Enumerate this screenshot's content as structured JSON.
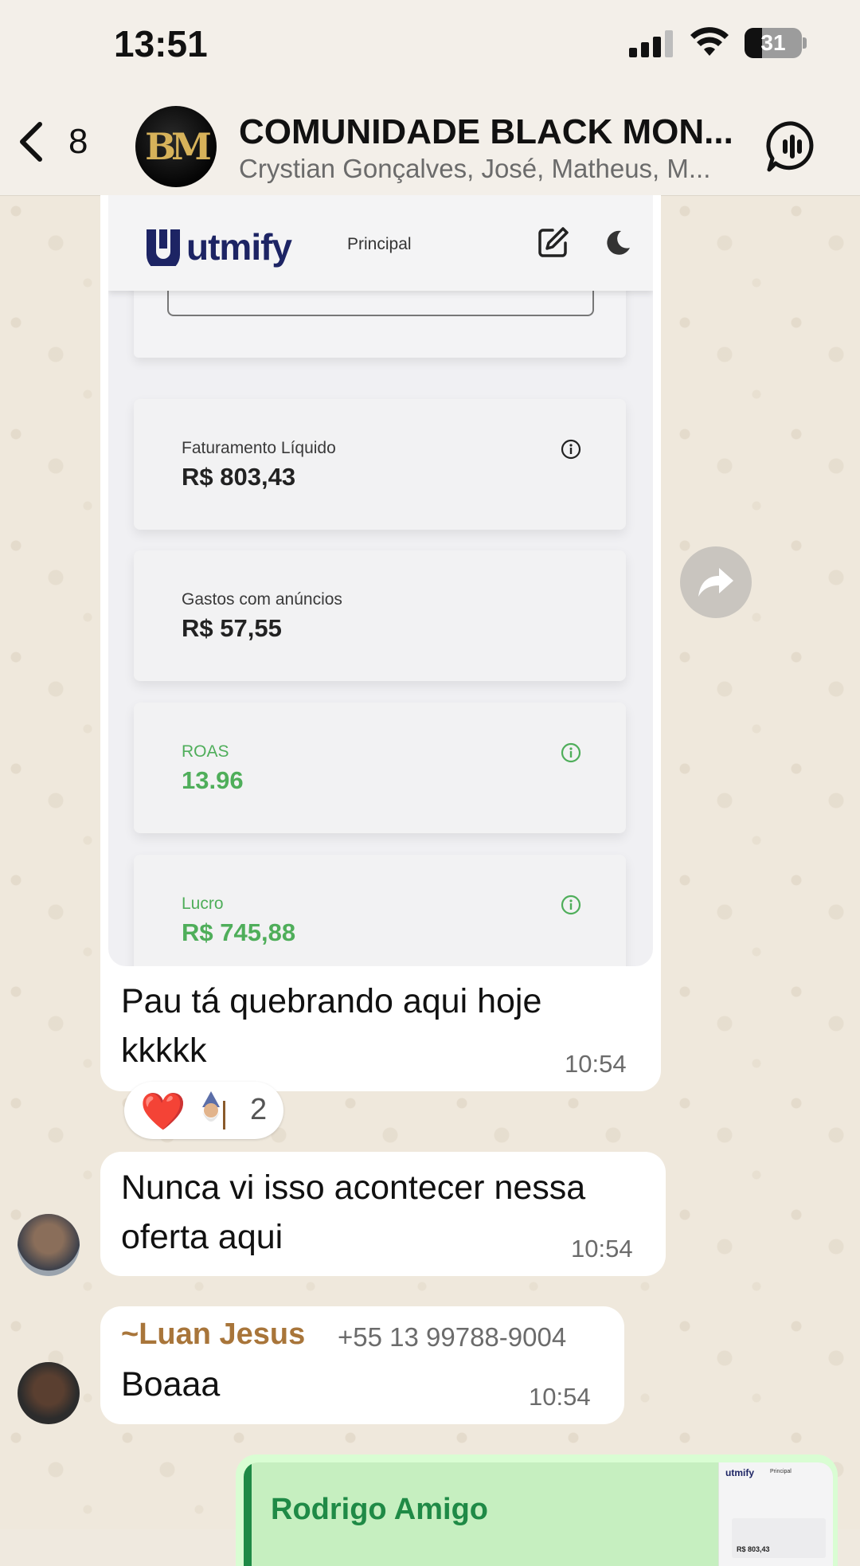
{
  "status_bar": {
    "time": "13:51",
    "battery": "31",
    "battery_fraction": 0.31
  },
  "header": {
    "back_count": "8",
    "avatar_initials": "BM",
    "title": "COMUNIDADE BLACK MON...",
    "members": "Crystian Gonçalves, José, Matheus, M..."
  },
  "messages": [
    {
      "type": "image",
      "screenshot": {
        "logo_text": "utmify",
        "nav_label": "Principal",
        "cards": [
          {
            "label": "Faturamento Líquido",
            "value": "R$ 803,43",
            "info": true,
            "color": "#222222"
          },
          {
            "label": "Gastos com anúncios",
            "value": "R$ 57,55",
            "info": false,
            "color": "#222222"
          },
          {
            "label": "ROAS",
            "value": "13.96",
            "info": true,
            "color": "#4fae5a"
          },
          {
            "label": "Lucro",
            "value": "R$ 745,88",
            "info": true,
            "color": "#4fae5a"
          }
        ]
      },
      "caption": "Pau tá quebrando aqui hoje kkkkk",
      "time": "10:54",
      "reactions": {
        "emoji1": "❤️",
        "emoji2": "wizard-emoji",
        "count": "2"
      }
    },
    {
      "type": "text",
      "text": "Nunca vi isso acontecer nessa oferta aqui",
      "time": "10:54"
    },
    {
      "type": "text",
      "sender": "~Luan Jesus",
      "sender_phone": "+55 13 99788-9004",
      "text": "Boaaa",
      "time": "10:54"
    },
    {
      "type": "outgoing-reply",
      "quoted_name": "Rodrigo Amigo",
      "thumb_logo": "utmify",
      "thumb_nav": "Principal",
      "thumb_value": "R$ 803,43"
    }
  ],
  "colors": {
    "sender": "#a8753a",
    "quote_name": "#1f8a46",
    "outgoing_bubble": "#d9fdd3",
    "green_value": "#4fae5a"
  }
}
